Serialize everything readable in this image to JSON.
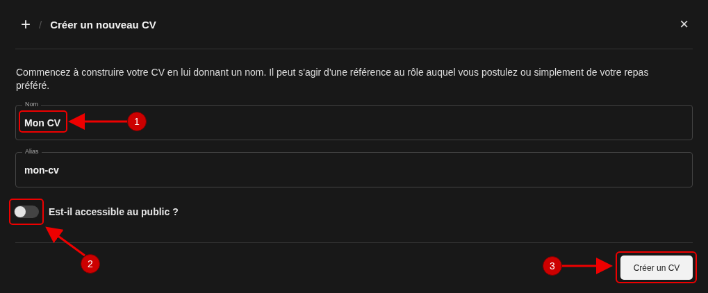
{
  "dialog": {
    "icon_text": "+",
    "separator": "/",
    "title": "Créer un nouveau CV",
    "close": "×"
  },
  "description": "Commencez à construire votre CV en lui donnant un nom. Il peut s'agir d'une référence au rôle auquel vous postulez ou simplement de votre repas préféré.",
  "fields": [
    {
      "label": "Nom",
      "value": "Mon CV"
    },
    {
      "label": "Alias",
      "value": "mon-cv"
    }
  ],
  "public_toggle": {
    "label": "Est-il accessible au public ?",
    "on": false
  },
  "buttons": [
    {
      "label": "Créer un CV"
    }
  ],
  "annotations": [
    {
      "label": "1"
    },
    {
      "label": "2"
    },
    {
      "label": "3"
    }
  ]
}
